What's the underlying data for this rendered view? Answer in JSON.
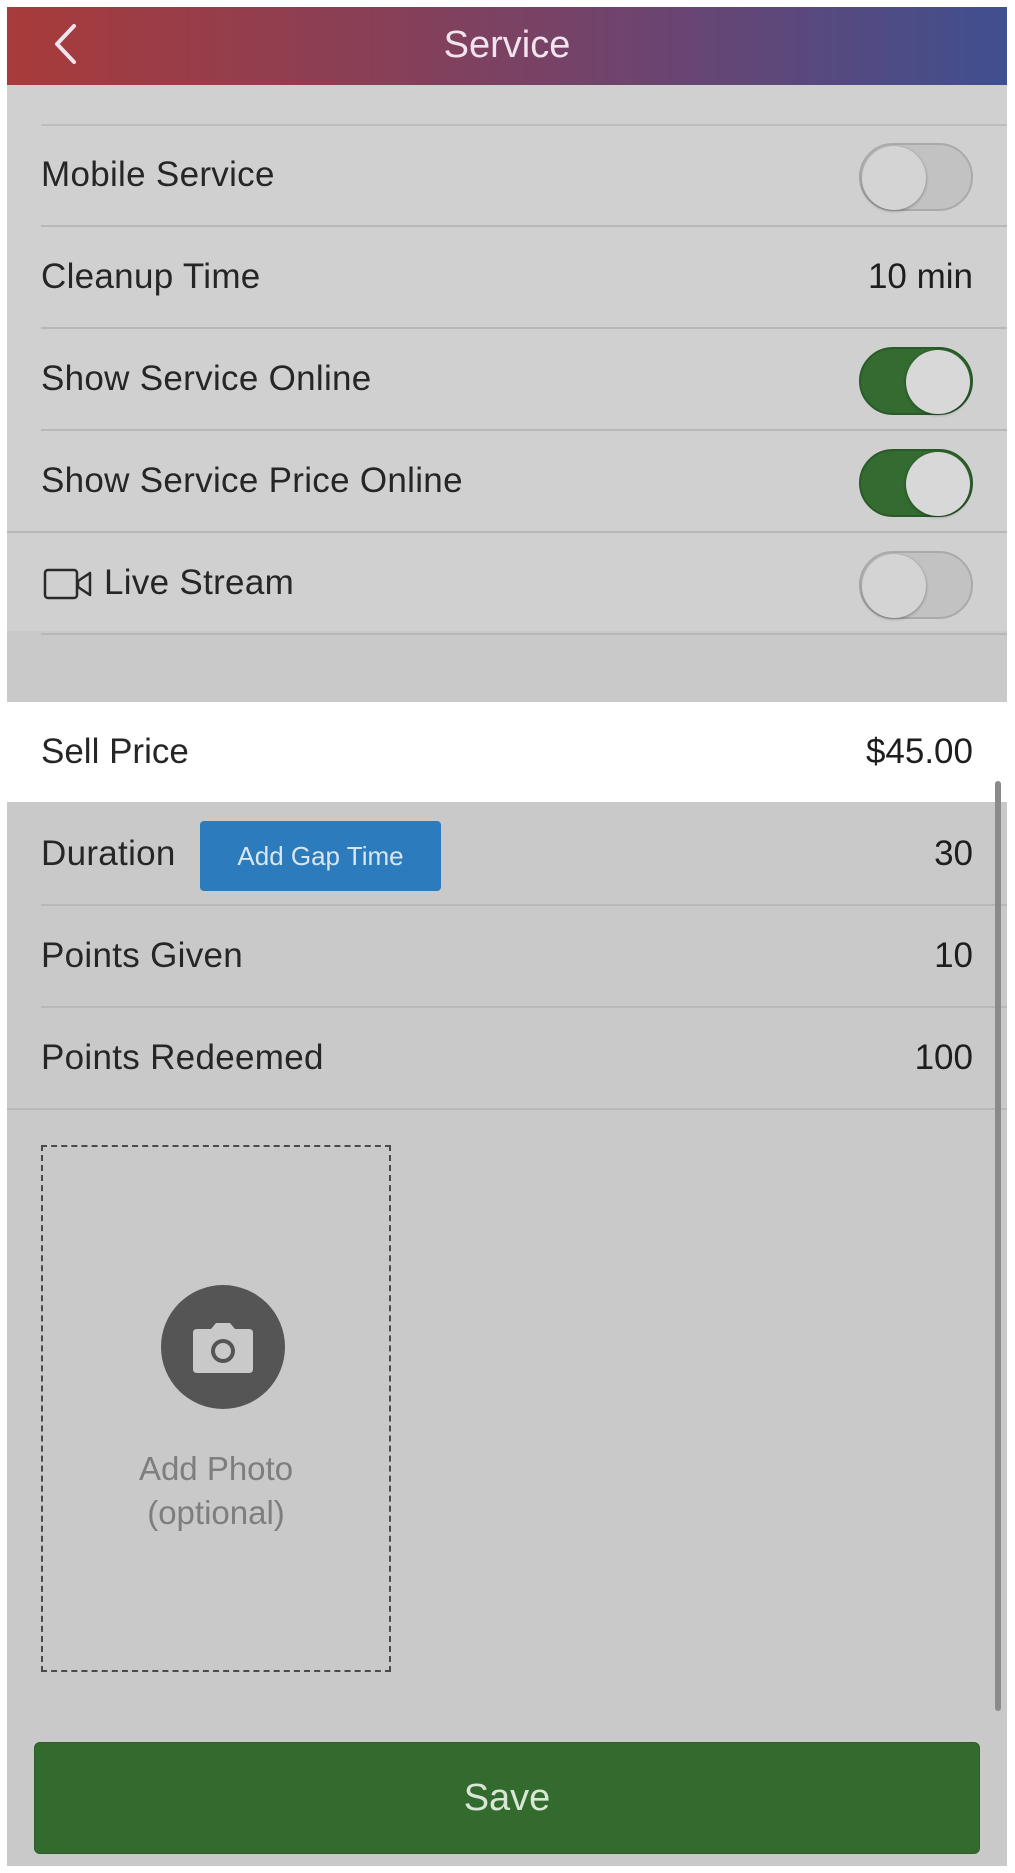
{
  "header": {
    "title": "Service"
  },
  "settings": {
    "mobile_service": {
      "label": "Mobile Service",
      "on": false
    },
    "cleanup_time": {
      "label": "Cleanup Time",
      "value": "10 min"
    },
    "show_online": {
      "label": "Show Service Online",
      "on": true
    },
    "show_price_online": {
      "label": "Show Service Price Online",
      "on": true
    },
    "live_stream": {
      "label": "Live Stream",
      "on": false,
      "icon": "video-camera-icon"
    }
  },
  "pricing": {
    "sell_price": {
      "label": "Sell Price",
      "value": "$45.00"
    },
    "duration": {
      "label": "Duration",
      "button": "Add Gap Time",
      "value": "30"
    },
    "points_given": {
      "label": "Points Given",
      "value": "10"
    },
    "points_redeemed": {
      "label": "Points Redeemed",
      "value": "100"
    }
  },
  "photo": {
    "line1": "Add Photo",
    "line2": "(optional)",
    "icon": "camera-icon"
  },
  "save_label": "Save",
  "colors": {
    "header_start": "#a83b3b",
    "header_end": "#404f8f",
    "toggle_on": "#336b31",
    "button_blue": "#2b7bbd",
    "save_green": "#336b2f"
  }
}
